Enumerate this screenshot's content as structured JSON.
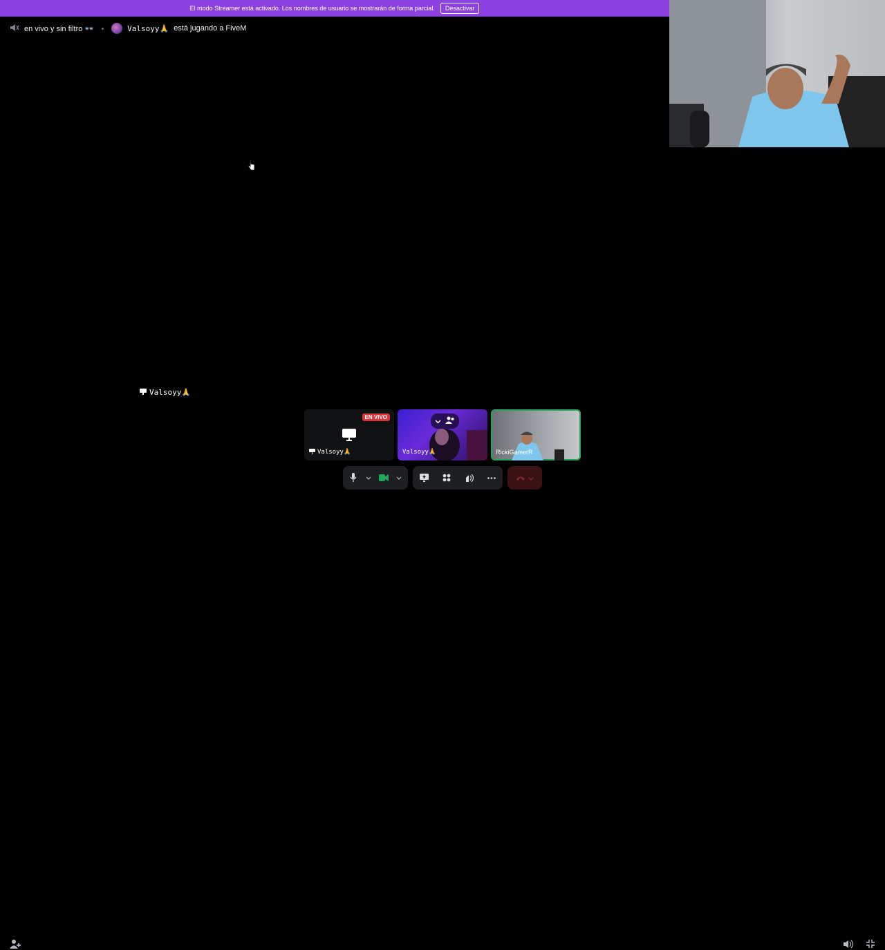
{
  "banner": {
    "text": "El modo Streamer está activado. Los nombres de usuario se mostrarán de forma parcial.",
    "button_label": "Desactivar"
  },
  "topbar": {
    "channel_name": "en vivo y sin filtro 👓",
    "user_name": "Valsoyy🙏",
    "activity": "está jugando a FiveM"
  },
  "stage": {
    "share_label": "Valsoyy🙏"
  },
  "tiles": [
    {
      "live_badge": "EN VIVO",
      "label": "Valsoyy🙏"
    },
    {
      "label": "Valsoyy🙏"
    },
    {
      "label": "RickiGamerR"
    }
  ],
  "colors": {
    "banner": "#8c41e0",
    "live": "#da373c",
    "speaking": "#23a55a",
    "hangup": "#da373c"
  },
  "icons": [
    "speaker-muted-icon",
    "monitor-icon",
    "microphone-icon",
    "camera-icon",
    "screen-share-icon",
    "activities-icon",
    "soundboard-icon",
    "more-icon",
    "hangup-icon",
    "volume-icon",
    "minimize-icon",
    "add-person-icon"
  ]
}
